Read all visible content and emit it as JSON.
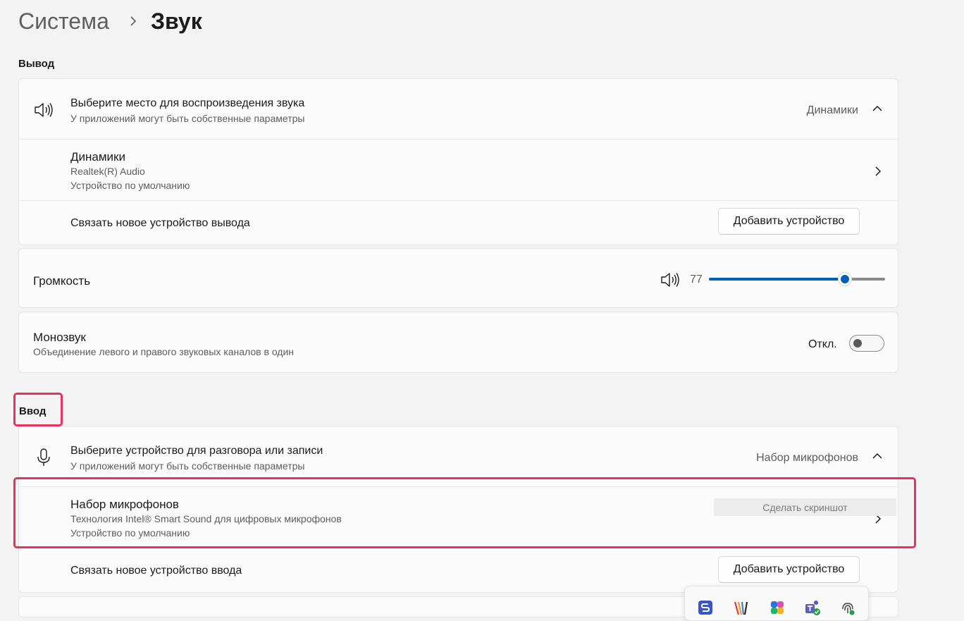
{
  "breadcrumb": {
    "parent": "Система",
    "current": "Звук"
  },
  "output": {
    "section_title": "Вывод",
    "choose": {
      "title": "Выберите место для воспроизведения звука",
      "subtitle": "У приложений могут быть собственные параметры",
      "value": "Динамики"
    },
    "device": {
      "name": "Динамики",
      "driver": "Realtek(R) Audio",
      "status": "Устройство по умолчанию"
    },
    "pair": {
      "label": "Связать новое устройство вывода",
      "button": "Добавить устройство"
    },
    "volume": {
      "label": "Громкость",
      "value": "77",
      "level": 0.77
    },
    "mono": {
      "title": "Монозвук",
      "subtitle": "Объединение левого и правого звуковых каналов в один",
      "state": "Откл."
    }
  },
  "input": {
    "section_title": "Ввод",
    "choose": {
      "title": "Выберите устройство для разговора или записи",
      "subtitle": "У приложений могут быть собственные параметры",
      "value": "Набор микрофонов"
    },
    "device": {
      "name": "Набор микрофонов",
      "driver": "Технология Intel® Smart Sound для цифровых микрофонов",
      "status": "Устройство по умолчанию"
    },
    "pair": {
      "label": "Связать новое устройство ввода",
      "button": "Добавить устройство"
    }
  },
  "screenshot_tip": "Сделать скриншот",
  "colors": {
    "accent": "#005fb8",
    "highlight": "#e8325a"
  },
  "tray_icons": [
    "snipping-tool-icon",
    "colorful-app-icon",
    "copilot-icon",
    "teams-icon",
    "fingerprint-icon"
  ]
}
